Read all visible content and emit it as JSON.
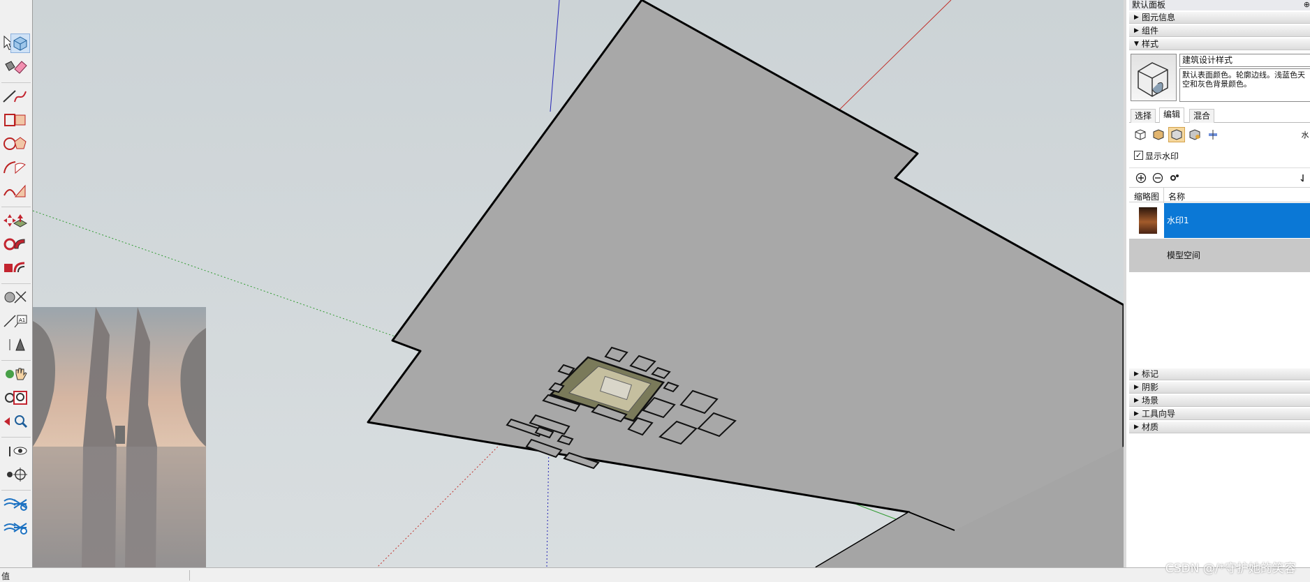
{
  "tray": {
    "title": "默认面板",
    "pin": "⊕",
    "sections_top": [
      {
        "label": "图元信息",
        "state": "collapsed"
      },
      {
        "label": "组件",
        "state": "collapsed"
      },
      {
        "label": "样式",
        "state": "expanded"
      }
    ],
    "style": {
      "name": "建筑设计样式",
      "description": "默认表面颜色。轮廓边线。浅蓝色天空和灰色背景颜色。"
    },
    "tabs": [
      {
        "label": "选择",
        "active": false
      },
      {
        "label": "编辑",
        "active": true
      },
      {
        "label": "混合",
        "active": false
      }
    ],
    "edit_icons": [
      "edge-settings-icon",
      "face-settings-icon",
      "background-settings-icon",
      "watermark-settings-icon",
      "modeling-settings-icon"
    ],
    "watermark_checkbox": {
      "label": "显示水印",
      "checked": true
    },
    "list_headers": {
      "thumbnail": "缩略图",
      "name": "名称"
    },
    "watermark_rows": [
      {
        "name": "水印1",
        "selected": true
      }
    ],
    "model_space_label": "模型空间",
    "sections_bottom": [
      {
        "label": "标记",
        "state": "collapsed"
      },
      {
        "label": "阴影",
        "state": "collapsed"
      },
      {
        "label": "场景",
        "state": "collapsed"
      },
      {
        "label": "工具向导",
        "state": "collapsed"
      },
      {
        "label": "材质",
        "state": "collapsed"
      }
    ]
  },
  "statusbar": {
    "text": "值"
  },
  "credit": "CSDN @/*守护她的笑容",
  "colors": {
    "selection_blue": "#0b78d6",
    "axis_red": "#c0302a",
    "axis_green": "#2f9a2f",
    "axis_blue": "#2323b5",
    "terrain_gray": "#a8a8a8"
  }
}
